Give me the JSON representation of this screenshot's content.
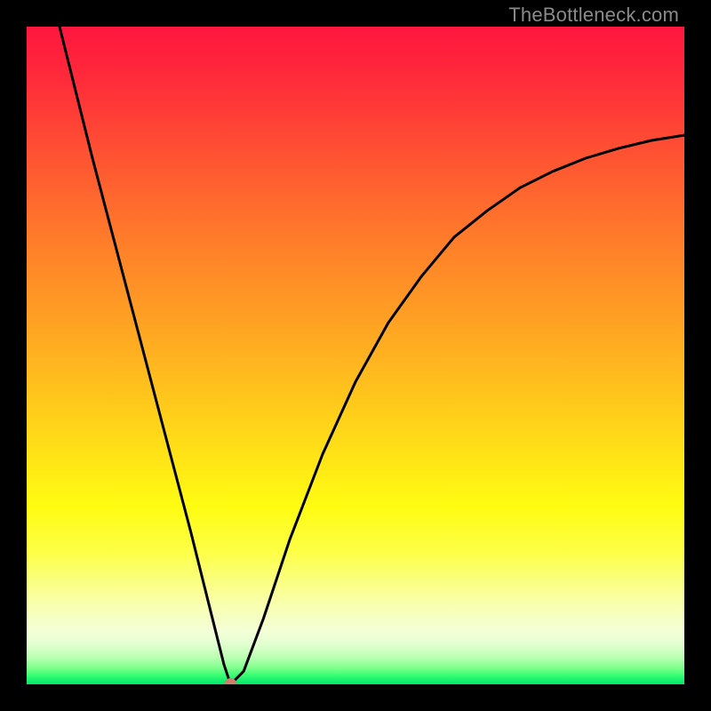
{
  "watermark": "TheBottleneck.com",
  "colors": {
    "frame": "#000000",
    "curve": "#000000",
    "marker": "#cf8170",
    "gradient_top": "#ff163f",
    "gradient_bottom": "#00e66b"
  },
  "chart_data": {
    "type": "line",
    "title": "",
    "xlabel": "",
    "ylabel": "",
    "xlim": [
      0,
      100
    ],
    "ylim": [
      0,
      100
    ],
    "grid": false,
    "legend": false,
    "notes": "V-shaped curve; left branch near-linear steep descent from top-left to minimum; right branch concave-increasing asymptotic curve. Gradient background red→yellow→green top→bottom. Minimum marked with small salmon dot.",
    "series": [
      {
        "name": "curve",
        "x": [
          5,
          10,
          15,
          20,
          25,
          28,
          30,
          31,
          33,
          36,
          40,
          45,
          50,
          55,
          60,
          65,
          70,
          75,
          80,
          85,
          90,
          95,
          100
        ],
        "y": [
          100,
          80,
          61,
          42,
          23,
          11,
          3,
          0,
          2,
          10,
          22,
          35,
          46,
          55,
          62,
          68,
          72,
          75.5,
          78,
          80,
          81.5,
          82.7,
          83.5
        ]
      }
    ],
    "marker": {
      "x": 31,
      "y": 0
    }
  }
}
